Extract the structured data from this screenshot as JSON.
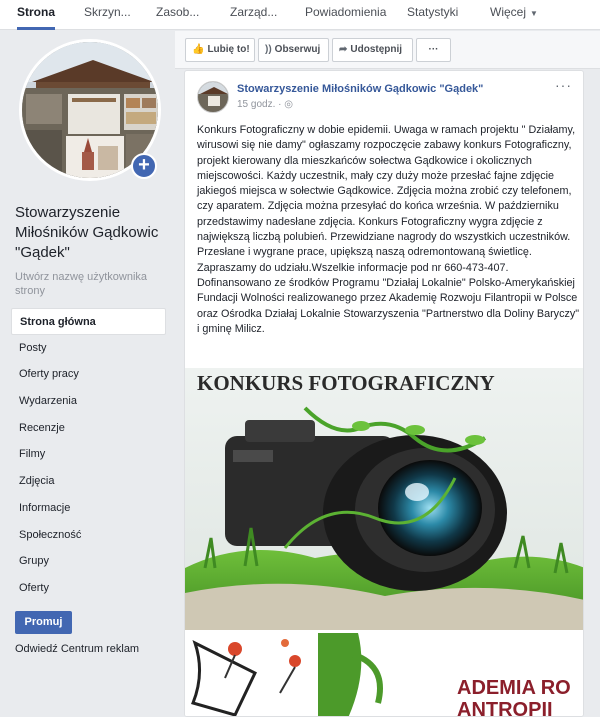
{
  "tabs": [
    {
      "label": "Strona",
      "active": true
    },
    {
      "label": "Skrzyn...",
      "active": false
    },
    {
      "label": "Zasob...",
      "active": false
    },
    {
      "label": "Zarząd...",
      "active": false
    },
    {
      "label": "Powiadomienia",
      "active": false
    },
    {
      "label": "Statystyki",
      "active": false
    },
    {
      "label": "Więcej",
      "active": false
    }
  ],
  "page": {
    "name": "Stowarzyszenie Miłośników Gądkowic \"Gądek\"",
    "username_hint": "Utwórz nazwę użytkownika strony"
  },
  "nav": [
    {
      "label": "Strona główna",
      "active": true
    },
    {
      "label": "Posty"
    },
    {
      "label": "Oferty pracy"
    },
    {
      "label": "Wydarzenia"
    },
    {
      "label": "Recenzje"
    },
    {
      "label": "Filmy"
    },
    {
      "label": "Zdjęcia"
    },
    {
      "label": "Informacje"
    },
    {
      "label": "Społeczność"
    },
    {
      "label": "Grupy"
    },
    {
      "label": "Oferty"
    }
  ],
  "promo": {
    "label": "Promuj",
    "ads_link": "Odwiedź Centrum reklam"
  },
  "actions": {
    "like": "Lubię to!",
    "follow": "Obserwuj",
    "share": "Udostępnij",
    "more": "···"
  },
  "post": {
    "author": "Stowarzyszenie Miłośników Gądkowic \"Gądek\"",
    "time": "15 godz.",
    "privacy_icon": "globe-icon",
    "more": "···",
    "text": "Konkurs Fotograficzny w dobie epidemii. Uwaga w ramach projektu \" Działamy, wirusowi się nie damy\" ogłaszamy rozpoczęcie zabawy konkurs Fotograficzny, projekt kierowany dla mieszkańców sołectwa Gądkowice i okolicznych miejscowości. Każdy uczestnik, mały czy duży może przesłać fajne zdjęcie jakiegoś miejsca w sołectwie Gądkowice. Zdjęcia można zrobić czy telefonem, czy aparatem. Zdjęcia można przesyłać do końca września. W październiku przedstawimy nadesłane zdjęcia. Konkurs Fotograficzny wygra zdjęcie z największą liczbą polubień. Przewidziane nagrody do wszystkich uczestników. Przesłane i wygrane prace, upiększą naszą odremontowaną świetlicę. Zapraszamy do udziału.Wszelkie informacje pod nr 660-473-407. Dofinansowano ze środków Programu \"Działaj Lokalnie\" Polsko-Amerykańskiej Fundacji Wolności realizowanego przez Akademię Rozwoju Filantropii w Polsce oraz Ośrodka Działaj Lokalnie Stowarzyszenia \"Partnerstwo dla Doliny Baryczy\" i gminę Milicz.",
    "image_title": "KONKURS FOTOGRAFICZNY",
    "thumb_text_1": "ADEMIA RO",
    "thumb_text_2": "ANTROPII"
  },
  "colors": {
    "accent": "#4267b2",
    "link": "#365899",
    "background": "#e9ebee",
    "poster_title": "#2a2a2a",
    "academy": "#8b1f2b"
  }
}
